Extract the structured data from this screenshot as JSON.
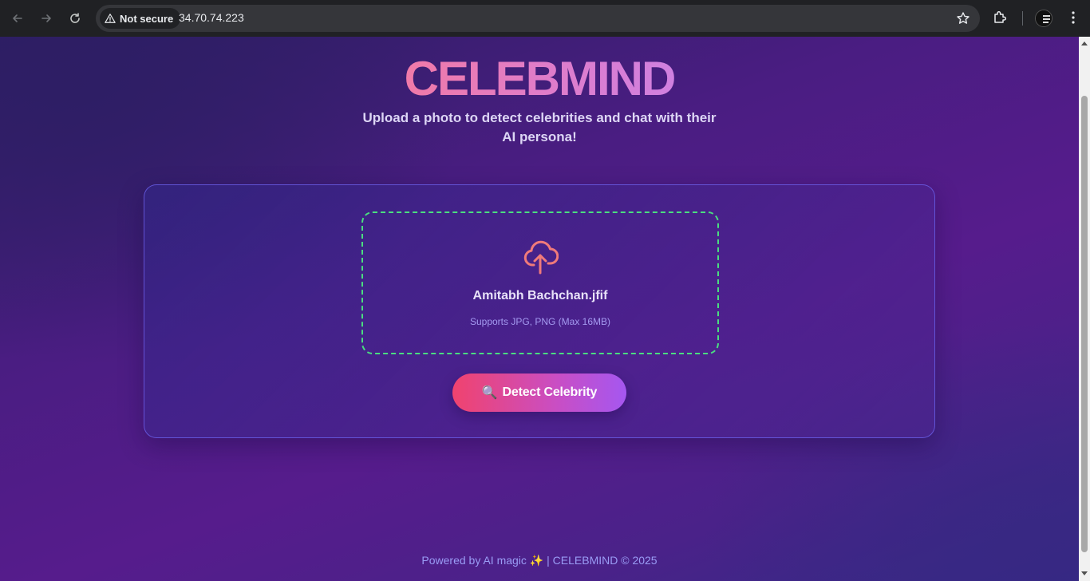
{
  "browser": {
    "security_label": "Not secure",
    "url": "34.70.74.223"
  },
  "page": {
    "logo": "CELEBMIND",
    "subtitle": "Upload a photo to detect celebrities and chat with their AI persona!",
    "upload": {
      "file_name": "Amitabh Bachchan.jfif",
      "hint": "Supports JPG, PNG (Max 16MB)",
      "icon": "cloud-upload-icon",
      "border_color": "#4ade80"
    },
    "detect_button": {
      "icon": "🔍",
      "label": "Detect Celebrity"
    },
    "footer": {
      "text_before": "Powered by AI magic",
      "sparkle": "✨",
      "text_after": "| CELEBMIND © 2025"
    }
  },
  "colors": {
    "accent_pink": "#f0436e",
    "accent_purple": "#a557f0",
    "background": "#561c8c"
  }
}
